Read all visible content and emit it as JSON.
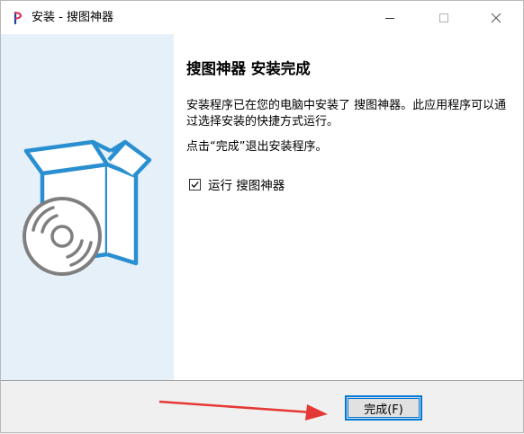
{
  "window": {
    "title": "安装 - 搜图神器"
  },
  "content": {
    "heading": "搜图神器 安装完成",
    "paragraph1": "安装程序已在您的电脑中安装了 搜图神器。此应用程序可以通过选择安装的快捷方式运行。",
    "paragraph2": "点击“完成”退出安装程序。",
    "run_checkbox": {
      "label": "运行 搜图神器",
      "checked": true
    }
  },
  "footer": {
    "finish_label": "完成(F)"
  },
  "colors": {
    "accent": "#0078d7",
    "banner_bg": "#e6f0f8",
    "box_outline": "#2a8fd0",
    "disc": "#7f7f7f",
    "annotation_arrow": "#e53935"
  },
  "icons": {
    "app": "app-logo-icon",
    "minimize": "minimize-icon",
    "maximize": "maximize-icon",
    "close": "close-icon",
    "box": "software-box-icon",
    "disc": "disc-icon",
    "check": "checkmark-icon",
    "arrow": "red-arrow-annotation"
  }
}
